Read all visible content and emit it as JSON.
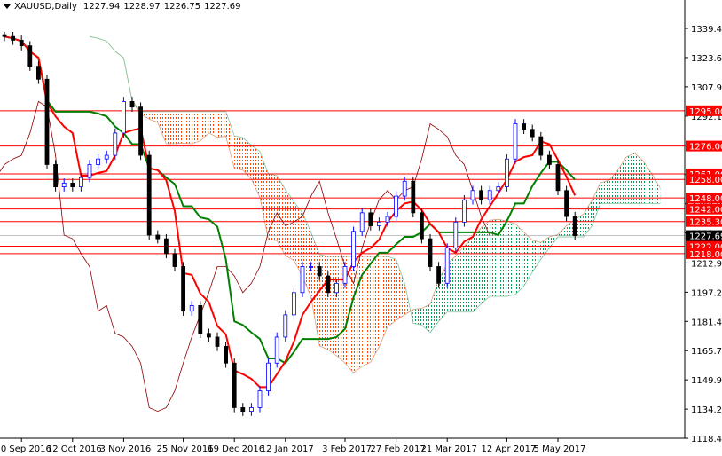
{
  "header": {
    "symbol": "XAUUSD,Daily",
    "open": "1227.94",
    "high": "1228.97",
    "low": "1226.75",
    "close": "1227.69"
  },
  "colors": {
    "bull": "#0000ff",
    "bear": "#000000",
    "tenkan": "#ff0000",
    "kijun": "#008000",
    "chikou": "#8b0000",
    "cloud_bull": "#00a050",
    "cloud_bear": "#ff4500",
    "level": "#ff0000",
    "label_bg": "#ff0000",
    "current_bg": "#000000"
  },
  "chart_data": {
    "type": "candlestick",
    "title": "XAUUSD,Daily",
    "indicator": "Ichimoku Kinko Hyo",
    "ylim": [
      1112,
      1346
    ],
    "y_ticks": [
      "1339.40",
      "1323.65",
      "1307.90",
      "1292.15",
      "1276.40",
      "1260.65",
      "1244.90",
      "1229.15",
      "1212.95",
      "1197.20",
      "1181.45",
      "1165.70",
      "1149.95",
      "1134.20",
      "1118.45"
    ],
    "x_labels": [
      {
        "label": "20 Sep 2016",
        "index": 2
      },
      {
        "label": "12 Oct 2016",
        "index": 8
      },
      {
        "label": "3 Nov 2016",
        "index": 14
      },
      {
        "label": "25 Nov 2016",
        "index": 21
      },
      {
        "label": "19 Dec 2016",
        "index": 27
      },
      {
        "label": "12 Jan 2017",
        "index": 33
      },
      {
        "label": "3 Feb 2017",
        "index": 40
      },
      {
        "label": "27 Feb 2017",
        "index": 46
      },
      {
        "label": "21 Mar 2017",
        "index": 52
      },
      {
        "label": "12 Apr 2017",
        "index": 59
      },
      {
        "label": "5 May 2017",
        "index": 65
      }
    ],
    "closes": [
      1335,
      1333,
      1330,
      1319,
      1312,
      1266,
      1254,
      1256,
      1254,
      1259,
      1266,
      1269,
      1271,
      1283,
      1300,
      1297,
      1271,
      1228,
      1226,
      1218,
      1211,
      1187,
      1190,
      1175,
      1173,
      1168,
      1159,
      1135,
      1133,
      1135,
      1144,
      1159,
      1173,
      1185,
      1197,
      1211,
      1211,
      1206,
      1197,
      1202,
      1211,
      1230,
      1240,
      1233,
      1235,
      1238,
      1249,
      1257,
      1240,
      1226,
      1211,
      1202,
      1221,
      1235,
      1247,
      1252,
      1247,
      1252,
      1254,
      1269,
      1288,
      1285,
      1281,
      1271,
      1266,
      1252,
      1238,
      1227.69
    ],
    "levels": [
      {
        "value": 1295.0,
        "label": "1295.00"
      },
      {
        "value": 1276.0,
        "label": "1276.00"
      },
      {
        "value": 1261.0,
        "label": "1261.00"
      },
      {
        "value": 1258.0,
        "label": "1258.00"
      },
      {
        "value": 1248.0,
        "label": "1248.00"
      },
      {
        "value": 1242.0,
        "label": "1242.00"
      },
      {
        "value": 1235.3,
        "label": "1235.30"
      },
      {
        "value": 1222.0,
        "label": "1222.00"
      },
      {
        "value": 1218.0,
        "label": "1218.00"
      }
    ],
    "current_price": {
      "value": 1227.69,
      "label": "1227.69"
    },
    "ichimoku": {
      "tenkan": 4,
      "kijun": 10,
      "senkou_b": 21,
      "shift": 10
    }
  }
}
